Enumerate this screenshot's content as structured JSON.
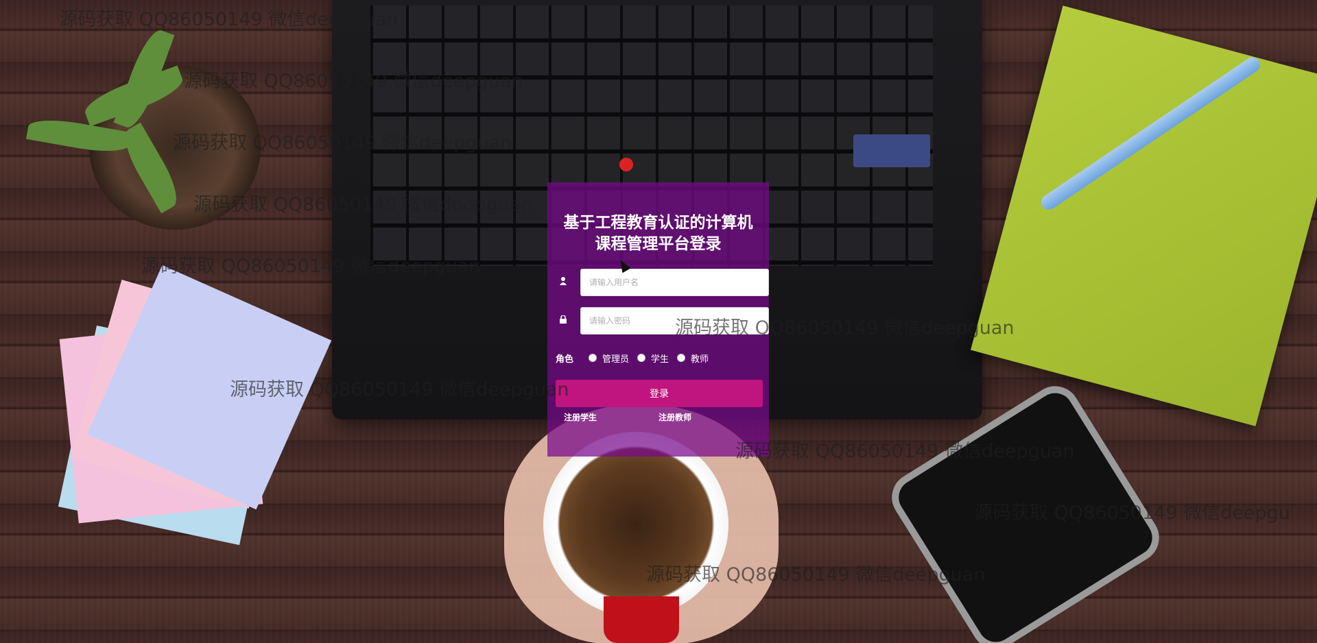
{
  "login": {
    "title_line1": "基于工程教育认证的计算机",
    "title_line2": "课程管理平台登录",
    "username_placeholder": "请输入用户名",
    "password_placeholder": "请输入密码",
    "role_label": "角色",
    "roles": [
      "管理员",
      "学生",
      "教师"
    ],
    "login_button": "登录",
    "register_student": "注册学生",
    "register_teacher": "注册教师"
  },
  "watermark": {
    "text": "源码获取 QQ86050149 微信deepguan",
    "truncated_text": "源码获取 QQ86050149 微信deepgu"
  },
  "icons": {
    "username": "user-icon",
    "password": "lock-icon"
  },
  "colors": {
    "panel": "#780a8c",
    "login_button": "#c0147e"
  }
}
